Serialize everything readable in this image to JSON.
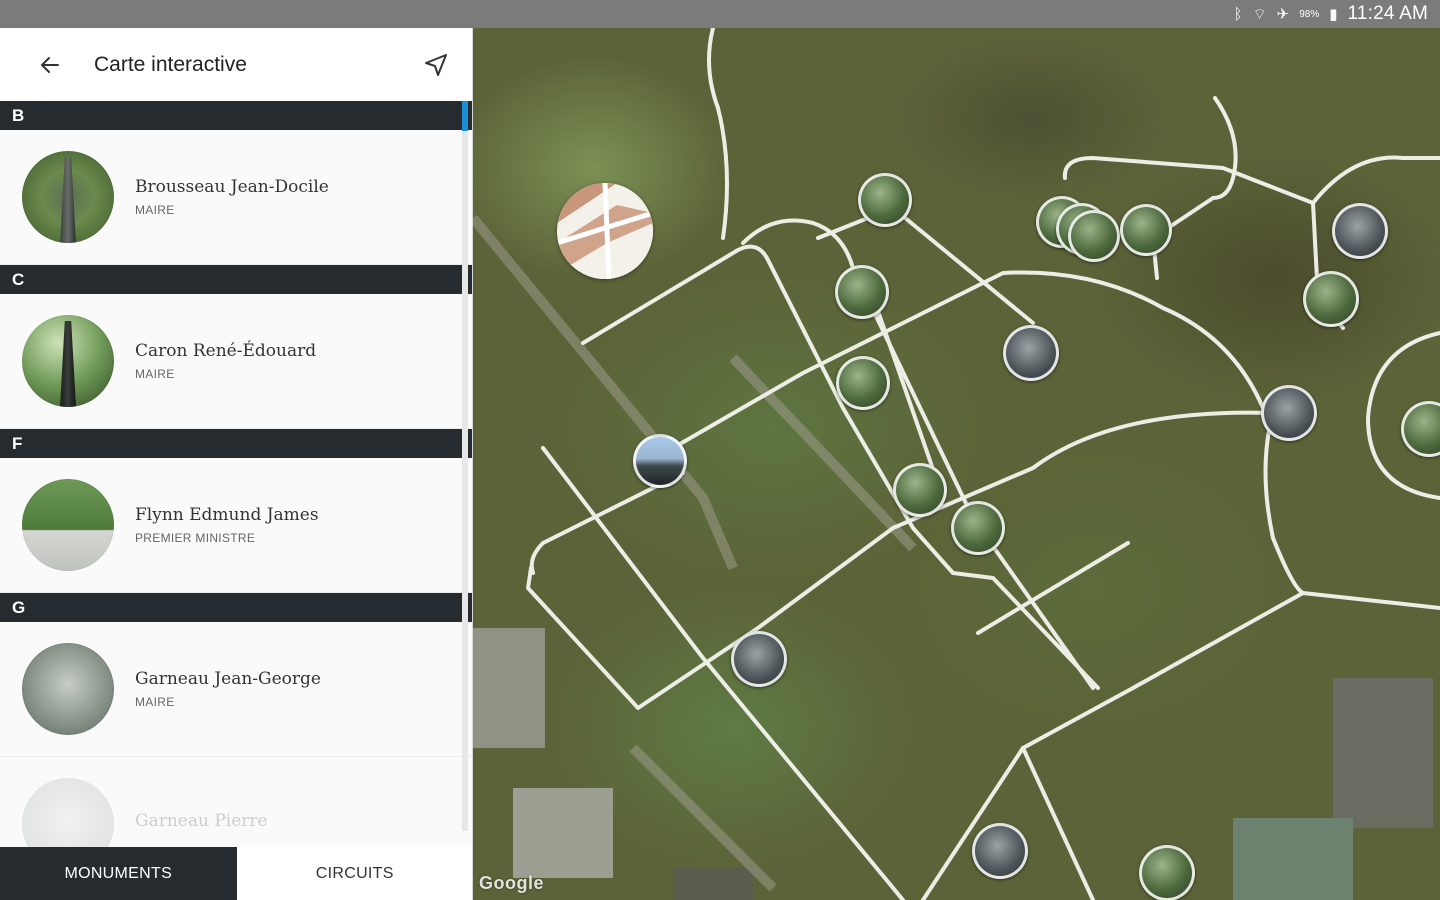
{
  "status_bar": {
    "icons": [
      "bluetooth-icon",
      "wifi-icon",
      "airplane-mode-icon",
      "battery-icon"
    ],
    "battery_percent": "98%",
    "time": "11:24 AM"
  },
  "toolbar": {
    "title": "Carte interactive",
    "back_icon": "arrow-left-icon",
    "nav_icon": "navigation-arrow-icon"
  },
  "sections": [
    {
      "letter": "B",
      "items": [
        {
          "name": "Brousseau Jean-Docile",
          "role": "MAIRE"
        }
      ]
    },
    {
      "letter": "C",
      "items": [
        {
          "name": "Caron René-Édouard",
          "role": "MAIRE"
        }
      ]
    },
    {
      "letter": "F",
      "items": [
        {
          "name": "Flynn Edmund James",
          "role": "PREMIER MINISTRE"
        }
      ]
    },
    {
      "letter": "G",
      "items": [
        {
          "name": "Garneau Jean-George",
          "role": "MAIRE"
        },
        {
          "name": "Garneau Pierre",
          "role": ""
        }
      ]
    }
  ],
  "tabs": [
    {
      "label": "MONUMENTS",
      "active": true
    },
    {
      "label": "CIRCUITS",
      "active": false
    }
  ],
  "map": {
    "attribution": "Google"
  },
  "colors": {
    "section_header": "#262b2f",
    "active_tab": "#262b2f",
    "scroll_accent": "#1a8fd6",
    "status_bar": "#7b7b7b"
  }
}
